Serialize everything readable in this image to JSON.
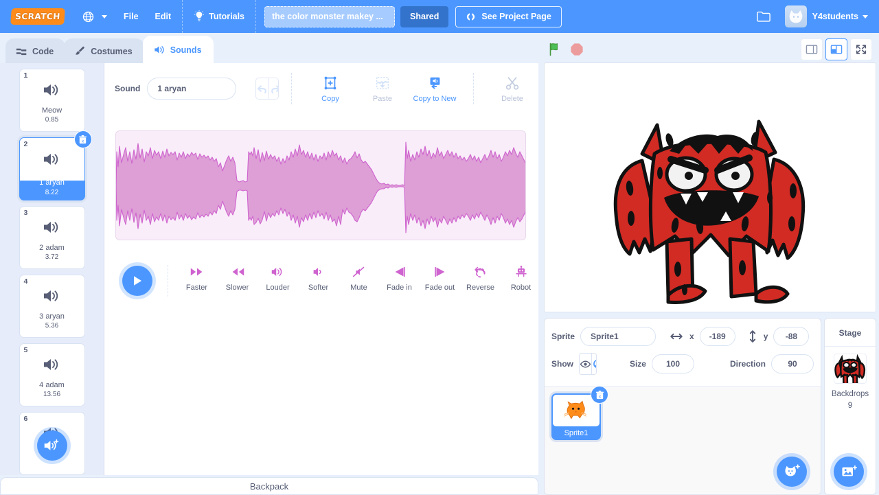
{
  "menubar": {
    "logo_text": "SCRATCH",
    "language_icon": "globe-icon",
    "file_label": "File",
    "edit_label": "Edit",
    "tutorials_label": "Tutorials",
    "tutorials_icon": "lightbulb-icon",
    "project_title": "the color monster makey ...",
    "shared_label": "Shared",
    "see_project_page_label": "See Project Page",
    "see_project_page_icon": "share-icon",
    "folder_icon": "folder-icon",
    "username": "Y4students"
  },
  "tabs": [
    {
      "label": "Code",
      "icon": "code-blocks-icon",
      "active": false
    },
    {
      "label": "Costumes",
      "icon": "paintbrush-icon",
      "active": false
    },
    {
      "label": "Sounds",
      "icon": "speaker-icon",
      "active": true
    }
  ],
  "sound_selector": {
    "add_button_icon": "add-sound-icon",
    "delete_badge_icon": "trash-icon",
    "items": [
      {
        "index": "1",
        "name": "Meow",
        "duration": "0.85",
        "selected": false
      },
      {
        "index": "2",
        "name": "1 aryan",
        "duration": "8.22",
        "selected": true
      },
      {
        "index": "3",
        "name": "2 adam",
        "duration": "3.72",
        "selected": false
      },
      {
        "index": "4",
        "name": "3 aryan",
        "duration": "5.36",
        "selected": false
      },
      {
        "index": "5",
        "name": "4 adam",
        "duration": "13.56",
        "selected": false
      },
      {
        "index": "6",
        "name": "",
        "duration": "",
        "selected": false
      }
    ]
  },
  "sound_editor": {
    "sound_label": "Sound",
    "sound_name_value": "1 aryan",
    "undo_icon": "undo-icon",
    "redo_icon": "redo-icon",
    "tools": [
      {
        "label": "Copy",
        "icon": "copy-icon",
        "disabled": false
      },
      {
        "label": "Paste",
        "icon": "paste-icon",
        "disabled": true
      },
      {
        "label": "Copy to New",
        "icon": "copy-to-new-icon",
        "disabled": false
      },
      {
        "label": "Delete",
        "icon": "scissors-icon",
        "disabled": true
      }
    ],
    "play_button_icon": "play-icon",
    "effects": [
      {
        "label": "Faster",
        "icon": "fast-forward-icon"
      },
      {
        "label": "Slower",
        "icon": "rewind-icon"
      },
      {
        "label": "Louder",
        "icon": "louder-speaker-icon"
      },
      {
        "label": "Softer",
        "icon": "softer-speaker-icon"
      },
      {
        "label": "Mute",
        "icon": "mute-icon"
      },
      {
        "label": "Fade in",
        "icon": "fade-in-icon"
      },
      {
        "label": "Fade out",
        "icon": "fade-out-icon"
      },
      {
        "label": "Reverse",
        "icon": "reverse-icon"
      },
      {
        "label": "Robot",
        "icon": "robot-icon"
      }
    ],
    "waveform_color": "#cf8ec8",
    "waveform_fill": "#dd9fd6",
    "waveform_background": "#f9edf9"
  },
  "backpack": {
    "label": "Backpack"
  },
  "stage_controls": {
    "green_flag_icon": "green-flag-icon",
    "stop_icon": "stop-sign-icon",
    "small_stage_icon": "small-stage-icon",
    "large_stage_icon": "large-stage-icon",
    "fullscreen_icon": "fullscreen-icon"
  },
  "stage": {
    "backdrop_description": "hand-drawn red monster with horns and big open mouth"
  },
  "sprite_pane": {
    "sprite_label": "Sprite",
    "sprite_name_value": "Sprite1",
    "x_label": "x",
    "x_value": "-189",
    "x_icon": "arrows-horizontal-icon",
    "y_label": "y",
    "y_value": "-88",
    "y_icon": "arrows-vertical-icon",
    "show_label": "Show",
    "show_icon": "eye-icon",
    "hide_icon": "eye-crossed-icon",
    "size_label": "Size",
    "size_value": "100",
    "direction_label": "Direction",
    "direction_value": "90",
    "sprites": [
      {
        "name": "Sprite1",
        "selected": true,
        "delete_icon": "trash-icon"
      }
    ],
    "add_sprite_icon": "add-sprite-cat-icon"
  },
  "stage_pane": {
    "title": "Stage",
    "backdrops_label": "Backdrops",
    "backdrops_count": "9",
    "add_backdrop_icon": "add-backdrop-image-icon"
  },
  "colors": {
    "accent_blue": "#4c97ff",
    "menu_blue": "#4c97ff",
    "shared_blue": "#3373cc",
    "text_gray": "#575e75",
    "panel_bg": "#e8f0fc",
    "sound_pink": "#cf63cf"
  }
}
